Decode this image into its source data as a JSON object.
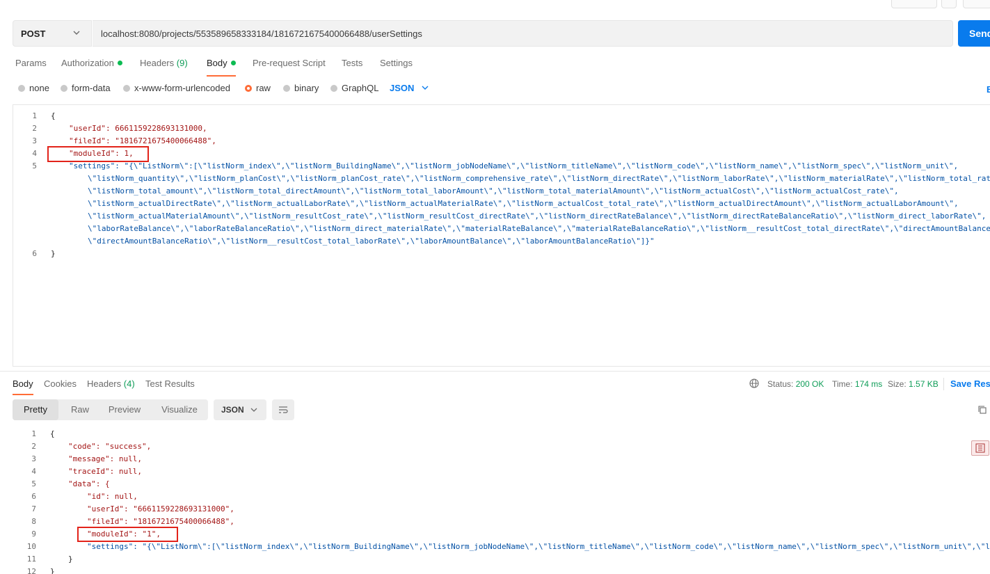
{
  "request": {
    "method": "POST",
    "url": "localhost:8080/projects/553589658333184/1816721675400066488/userSettings",
    "send_label": "Send"
  },
  "request_tabs": [
    {
      "label": "Params"
    },
    {
      "label": "Authorization",
      "dot": true
    },
    {
      "label": "Headers",
      "count": "(9)"
    },
    {
      "label": "Body",
      "dot": true,
      "active": true
    },
    {
      "label": "Pre-request Script"
    },
    {
      "label": "Tests"
    },
    {
      "label": "Settings"
    }
  ],
  "body_types": [
    "none",
    "form-data",
    "x-www-form-urlencoded",
    "raw",
    "binary",
    "GraphQL"
  ],
  "selected_body_type": "raw",
  "body_format": "JSON",
  "beautify_label": "B",
  "request_body": {
    "line_numbers": [
      "1",
      "2",
      "3",
      "4",
      "5",
      "",
      "",
      "",
      "",
      "",
      "6"
    ],
    "lines": [
      "{",
      "\"userId\": 6661159228693131000,",
      "\"fileId\": \"1816721675400066488\",",
      "\"moduleId\": 1,",
      "\"settings\": \"{\\\"ListNorm\\\":[\\\"listNorm_index\\\",\\\"listNorm_BuildingName\\\",\\\"listNorm_jobNodeName\\\",\\\"listNorm_titleName\\\",\\\"listNorm_code\\\",\\\"listNorm_name\\\",\\\"listNorm_spec\\\",\\\"listNorm_unit\\\",",
      "\\\"listNorm_quantity\\\",\\\"listNorm_planCost\\\",\\\"listNorm_planCost_rate\\\",\\\"listNorm_comprehensive_rate\\\",\\\"listNorm_directRate\\\",\\\"listNorm_laborRate\\\",\\\"listNorm_materialRate\\\",\\\"listNorm_total_rate\\\",",
      "\\\"listNorm_total_amount\\\",\\\"listNorm_total_directAmount\\\",\\\"listNorm_total_laborAmount\\\",\\\"listNorm_total_materialAmount\\\",\\\"listNorm_actualCost\\\",\\\"listNorm_actualCost_rate\\\",",
      "\\\"listNorm_actualDirectRate\\\",\\\"listNorm_actualLaborRate\\\",\\\"listNorm_actualMaterialRate\\\",\\\"listNorm_actualCost_total_rate\\\",\\\"listNorm_actualDirectAmount\\\",\\\"listNorm_actualLaborAmount\\\",",
      "\\\"listNorm_actualMaterialAmount\\\",\\\"listNorm_resultCost_rate\\\",\\\"listNorm_resultCost_directRate\\\",\\\"listNorm_directRateBalance\\\",\\\"listNorm_directRateBalanceRatio\\\",\\\"listNorm_direct_laborRate\\\",",
      "\\\"laborRateBalance\\\",\\\"laborRateBalanceRatio\\\",\\\"listNorm_direct_materialRate\\\",\\\"materialRateBalance\\\",\\\"materialRateBalanceRatio\\\",\\\"listNorm__resultCost_total_directRate\\\",\\\"directAmountBalance\\\",",
      "\\\"directAmountBalanceRatio\\\",\\\"listNorm__resultCost_total_laborRate\\\",\\\"laborAmountBalance\\\",\\\"laborAmountBalanceRatio\\\"]}\"",
      "}"
    ]
  },
  "response_tabs": [
    {
      "label": "Body",
      "active": true
    },
    {
      "label": "Cookies"
    },
    {
      "label": "Headers",
      "count": "(4)"
    },
    {
      "label": "Test Results"
    }
  ],
  "response_meta": {
    "status_label": "Status:",
    "status_value": "200 OK",
    "time_label": "Time:",
    "time_value": "174 ms",
    "size_label": "Size:",
    "size_value": "1.57 KB",
    "save_label": "Save Resp"
  },
  "view_modes": [
    "Pretty",
    "Raw",
    "Preview",
    "Visualize"
  ],
  "response_format": "JSON",
  "response_body": {
    "line_numbers": [
      "1",
      "2",
      "3",
      "4",
      "5",
      "6",
      "7",
      "8",
      "9",
      "10",
      "11",
      "12"
    ],
    "lines": [
      "{",
      "\"code\": \"success\",",
      "\"message\": null,",
      "\"traceId\": null,",
      "\"data\": {",
      "\"id\": null,",
      "\"userId\": \"6661159228693131000\",",
      "\"fileId\": \"1816721675400066488\",",
      "\"moduleId\": \"1\",",
      "\"settings\": \"{\\\"ListNorm\\\":[\\\"listNorm_index\\\",\\\"listNorm_BuildingName\\\",\\\"listNorm_jobNodeName\\\",\\\"listNorm_titleName\\\",\\\"listNorm_code\\\",\\\"listNorm_name\\\",\\\"listNorm_spec\\\",\\\"listNorm_unit\\\",\\\"li",
      "}",
      "}"
    ]
  },
  "colors": {
    "accent": "#ff6c37",
    "primary": "#097bed",
    "success": "#0f9d58",
    "highlight": "#e2231a"
  }
}
